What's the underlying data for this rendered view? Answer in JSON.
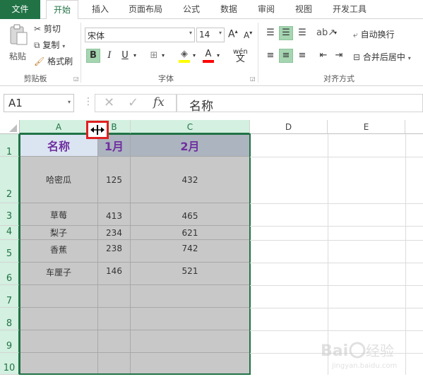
{
  "tabs": [
    "文件",
    "开始",
    "插入",
    "页面布局",
    "公式",
    "数据",
    "审阅",
    "视图",
    "开发工具"
  ],
  "clipboard": {
    "paste_label": "粘贴",
    "cut_label": "剪切",
    "copy_label": "复制",
    "format_painter_label": "格式刷",
    "group_label": "剪贴板"
  },
  "font": {
    "font_name": "宋体",
    "font_size": "14",
    "bold": "B",
    "italic": "I",
    "underline": "U",
    "increase_size": "A",
    "decrease_size": "A",
    "phonetic": "wén",
    "group_label": "字体"
  },
  "alignment": {
    "wrap_text_label": "自动换行",
    "merge_center_label": "合并后居中",
    "group_label": "对齐方式"
  },
  "formula_bar": {
    "name_box": "A1",
    "fx": "fx",
    "formula": "名称"
  },
  "columns": [
    "A",
    "B",
    "C",
    "D",
    "E"
  ],
  "rows": [
    "1",
    "2",
    "3",
    "4",
    "5",
    "6",
    "7",
    "8",
    "9",
    "10"
  ],
  "table": {
    "header": [
      "名称",
      "1月",
      "2月"
    ],
    "data": [
      [
        "哈密瓜",
        "125",
        "432"
      ],
      [
        "草莓",
        "413",
        "465"
      ],
      [
        "梨子",
        "234",
        "621"
      ],
      [
        "香蕉",
        "238",
        "742"
      ],
      [
        "车厘子",
        "146",
        "521"
      ]
    ]
  },
  "colors": {
    "accent": "#217346",
    "header_text": "#7030a0",
    "selection_fill": "#c8c8c8",
    "highlight_box": "#e02020"
  },
  "watermark": "Baidu经验 jingyan.baidu.com"
}
